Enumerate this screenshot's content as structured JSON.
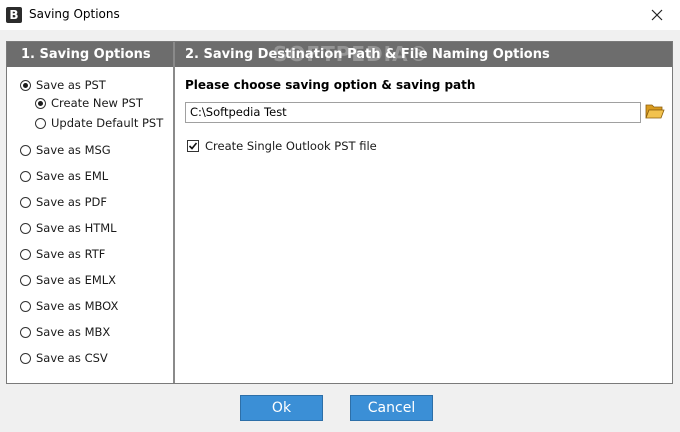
{
  "window": {
    "title": "Saving Options",
    "app_icon_letter": "B",
    "close_glyph": "✕"
  },
  "left_panel": {
    "header": "1. Saving Options",
    "options": [
      {
        "label": "Save as PST",
        "checked": true
      },
      {
        "label": "Create New PST",
        "checked": true,
        "sub": true
      },
      {
        "label": "Update Default PST",
        "checked": false,
        "sub": true
      },
      {
        "label": "Save as MSG",
        "checked": false
      },
      {
        "label": "Save as EML",
        "checked": false
      },
      {
        "label": "Save as PDF",
        "checked": false
      },
      {
        "label": "Save as HTML",
        "checked": false
      },
      {
        "label": "Save as RTF",
        "checked": false
      },
      {
        "label": "Save as EMLX",
        "checked": false
      },
      {
        "label": "Save as MBOX",
        "checked": false
      },
      {
        "label": "Save as MBX",
        "checked": false
      },
      {
        "label": "Save as CSV",
        "checked": false
      }
    ]
  },
  "right_panel": {
    "header": "2. Saving Destination Path & File Naming Options",
    "watermark": "SOFTPEDIA®",
    "section_title": "Please choose saving option & saving path",
    "path_value": "C:\\Softpedia Test",
    "checkbox_label": "Create Single Outlook PST file",
    "checkbox_checked": true
  },
  "buttons": {
    "ok": "Ok",
    "cancel": "Cancel"
  },
  "colors": {
    "header_bg": "#6d6d6d",
    "button_bg": "#3b8fd6",
    "folder_icon": "#e8b53a"
  },
  "icons": {
    "close": "close-icon",
    "folder": "folder-open-icon",
    "check": "checkmark-icon"
  }
}
